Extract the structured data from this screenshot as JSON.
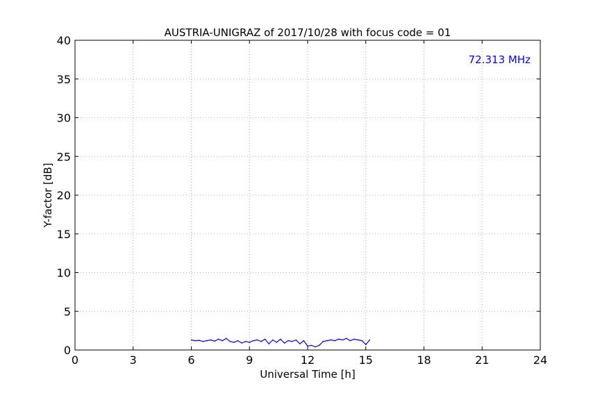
{
  "chart_data": {
    "type": "line",
    "title": "AUSTRIA-UNIGRAZ of 2017/10/28 with focus code = 01",
    "xlabel": "Universal Time [h]",
    "ylabel": "Y-factor [dB]",
    "xlim": [
      0,
      24
    ],
    "ylim": [
      0,
      40
    ],
    "xticks": [
      0,
      3,
      6,
      9,
      12,
      15,
      18,
      21,
      24
    ],
    "yticks": [
      0,
      5,
      10,
      15,
      20,
      25,
      30,
      35,
      40
    ],
    "grid": true,
    "annotation": {
      "text": "72.313 MHz",
      "color": "#0000ff",
      "placement": "top-right"
    },
    "series": [
      {
        "color": "#0000ff",
        "x": [
          6.0,
          6.2,
          6.4,
          6.6,
          6.8,
          7.0,
          7.2,
          7.4,
          7.6,
          7.8,
          8.0,
          8.2,
          8.4,
          8.6,
          8.8,
          9.0,
          9.2,
          9.4,
          9.6,
          9.8,
          10.0,
          10.2,
          10.4,
          10.6,
          10.8,
          11.0,
          11.2,
          11.4,
          11.6,
          11.8,
          12.0,
          12.2,
          12.4,
          12.6,
          12.8,
          13.0,
          13.2,
          13.4,
          13.6,
          13.8,
          14.0,
          14.2,
          14.4,
          14.6,
          14.8,
          15.0,
          15.2
        ],
        "y": [
          1.3,
          1.2,
          1.25,
          1.1,
          1.2,
          1.3,
          1.15,
          1.4,
          1.2,
          1.5,
          1.1,
          1.0,
          1.2,
          0.9,
          1.1,
          1.0,
          1.2,
          1.3,
          1.1,
          1.4,
          0.8,
          1.3,
          1.0,
          1.4,
          0.9,
          1.2,
          1.1,
          1.3,
          0.8,
          1.2,
          0.5,
          0.6,
          0.4,
          0.6,
          1.1,
          1.2,
          1.3,
          1.2,
          1.4,
          1.3,
          1.5,
          1.2,
          1.4,
          1.3,
          1.2,
          0.7,
          1.3
        ]
      }
    ]
  }
}
